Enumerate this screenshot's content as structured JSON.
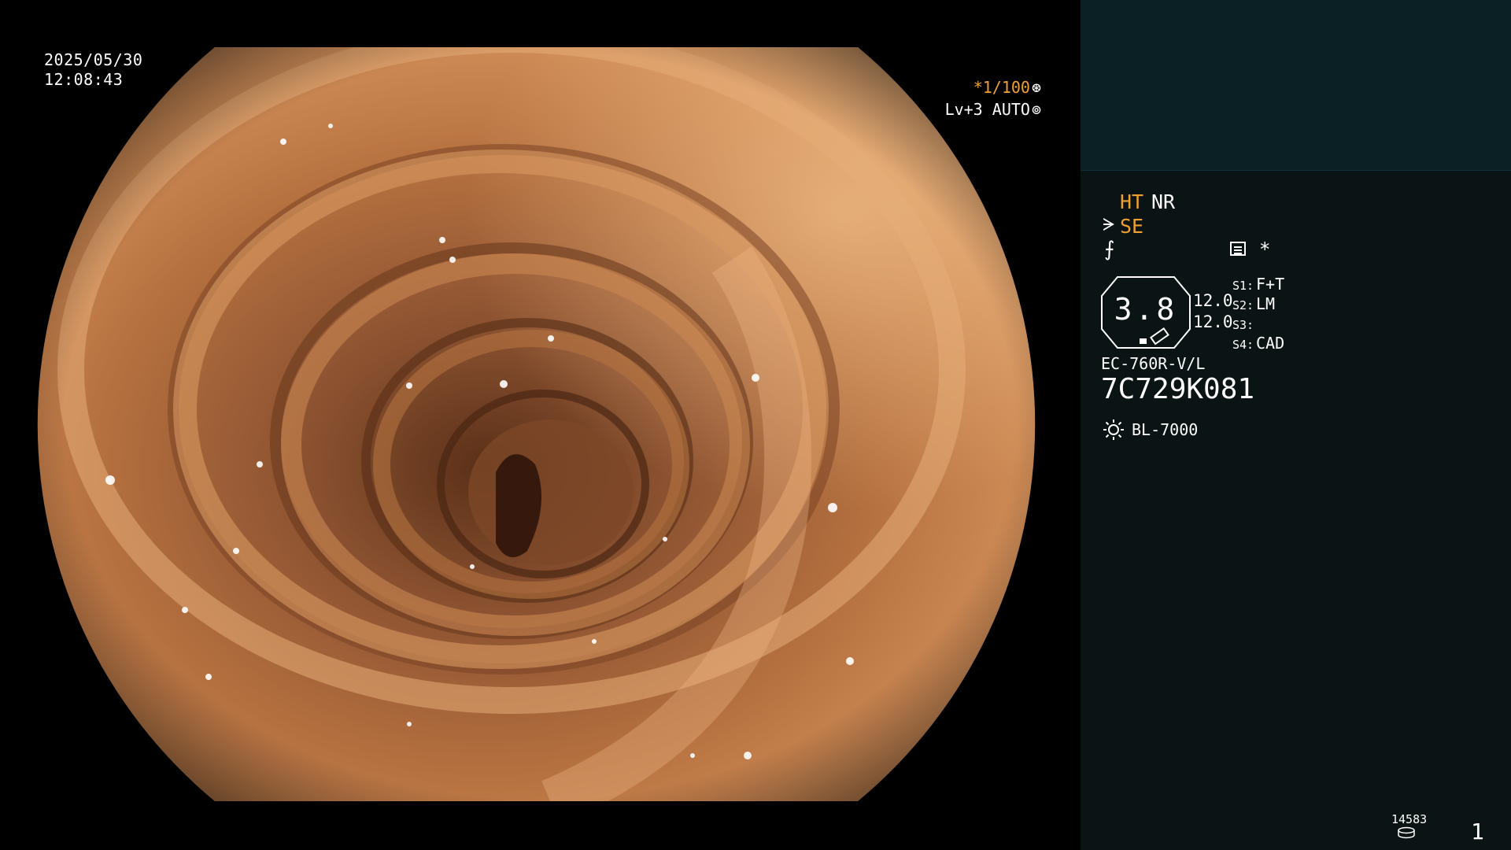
{
  "overlay": {
    "date": "2025/05/30",
    "time": "12:08:43",
    "shutter": "*1/100",
    "level": "Lv+3",
    "auto": "AUTO",
    "icons": [
      "aperture-icon",
      "iris-icon"
    ]
  },
  "panel": {
    "ht": "HT",
    "nr": "NR",
    "se": "SE",
    "star": "*",
    "zoom_value": "3.8",
    "val1": "12.0",
    "val2": "12.0",
    "switches": [
      {
        "key": "S1:",
        "value": "F+T"
      },
      {
        "key": "S2:",
        "value": "LM"
      },
      {
        "key": "S3:",
        "value": ""
      },
      {
        "key": "S4:",
        "value": "CAD"
      }
    ],
    "model": "EC-760R-V/L",
    "serial": "7C729K081",
    "light_source": "BL-7000",
    "counter": "14583",
    "page": "1"
  },
  "colors": {
    "accent_orange": "#f0a030",
    "panel_bg": "#0a1414",
    "panel_top_bg": "#0b2025",
    "mucosa": "#d4925a"
  }
}
